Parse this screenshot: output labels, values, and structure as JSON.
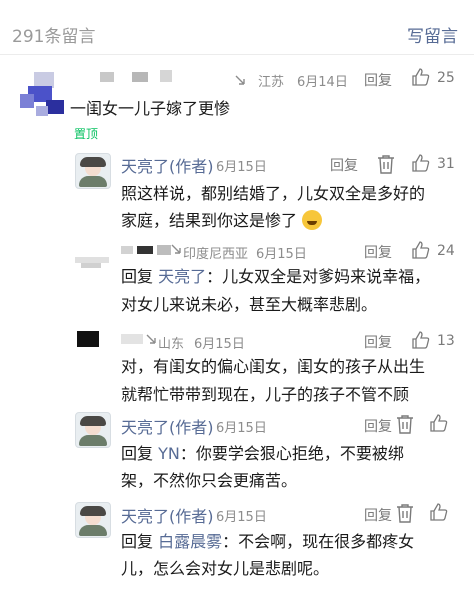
{
  "header": {
    "count_label": "291条留言",
    "write_label": "写留言"
  },
  "top_comment": {
    "region": "江苏",
    "date": "6月14日",
    "reply_label": "回复",
    "likes": "25",
    "text": "一闺女一儿子嫁了更惨",
    "pinned_label": "置顶"
  },
  "replies": [
    {
      "name": "天亮了(作者)",
      "date": "6月15日",
      "reply_label": "回复",
      "likes": "31",
      "line1": "照这样说，都别结婚了，儿女双全是多好的",
      "line2": "家庭，结果到你这是惨了"
    },
    {
      "region": "印度尼西亚",
      "date": "6月15日",
      "reply_label": "回复",
      "likes": "24",
      "reply_prefix": "回复 ",
      "reply_to": "天亮了",
      "line1": "：儿女双全是对爹妈来说幸福，",
      "line2": "对女儿来说未必，甚至大概率悲剧。"
    },
    {
      "region": "山东",
      "date": "6月15日",
      "reply_label": "回复",
      "likes": "13",
      "line1": "对，有闺女的偏心闺女，闺女的孩子从出生",
      "line2": "就帮忙带带到现在，儿子的孩子不管不顾"
    },
    {
      "name": "天亮了(作者)",
      "date": "6月15日",
      "reply_label": "回复",
      "reply_prefix": "回复 ",
      "reply_to": "YN",
      "line1": "：你要学会狠心拒绝，不要被绑",
      "line2": "架，不然你只会更痛苦。"
    },
    {
      "name": "天亮了(作者)",
      "date": "6月15日",
      "reply_label": "回复",
      "reply_prefix": "回复 ",
      "reply_to": "白露晨雾",
      "line1": "：不会啊，现在很多都疼女",
      "line2": "儿，怎么会对女儿是悲剧呢。"
    }
  ],
  "colors": {
    "link": "#576b95",
    "pinned": "#07c160",
    "meta": "#8c8c8c"
  }
}
